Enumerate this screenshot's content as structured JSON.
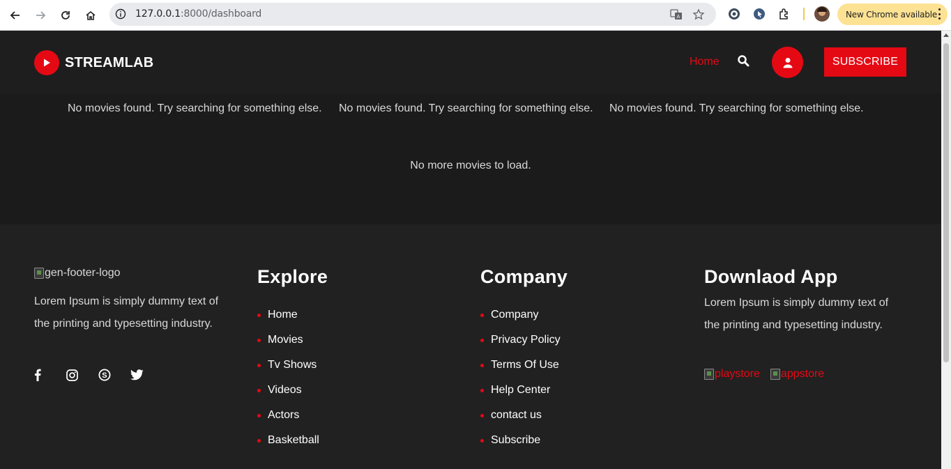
{
  "browser": {
    "url_host": "127.0.0.1",
    "url_port_path": ":8000/dashboard",
    "update_label": "New Chrome available"
  },
  "header": {
    "brand": "STREAMLAB",
    "nav_home": "Home",
    "subscribe_label": "SUBSCRIBE"
  },
  "content": {
    "empty_messages": [
      "No movies found. Try searching for something else.",
      "No movies found. Try searching for something else.",
      "No movies found. Try searching for something else."
    ],
    "no_more": "No more movies to load."
  },
  "footer": {
    "logo_alt": "gen-footer-logo",
    "description": "Lorem Ipsum is simply dummy text of the printing and typesetting industry.",
    "social_icons": [
      "facebook-icon",
      "instagram-icon",
      "skype-icon",
      "twitter-icon"
    ],
    "explore": {
      "title": "Explore",
      "items": [
        "Home",
        "Movies",
        "Tv Shows",
        "Videos",
        "Actors",
        "Basketball"
      ]
    },
    "company": {
      "title": "Company",
      "items": [
        "Company",
        "Privacy Policy",
        "Terms Of Use",
        "Help Center",
        "contact us",
        "Subscribe"
      ]
    },
    "download": {
      "title": "Downlaod App",
      "description": "Lorem Ipsum is simply dummy text of the printing and typesetting industry.",
      "playstore_alt": "playstore",
      "appstore_alt": "appstore"
    }
  },
  "colors": {
    "accent": "#e50914",
    "header_bg": "#1f1e1e",
    "content_bg": "#1b1b1b",
    "footer_bg": "#222121"
  }
}
